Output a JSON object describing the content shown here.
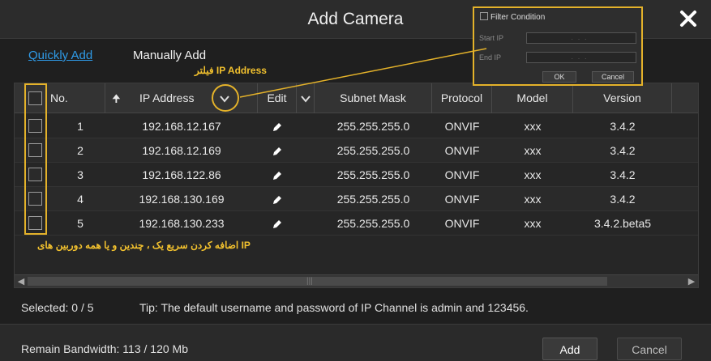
{
  "dialog": {
    "title": "Add Camera"
  },
  "tabs": [
    {
      "label": "Quickly Add",
      "active": true
    },
    {
      "label": "Manually Add",
      "active": false
    }
  ],
  "annotations": {
    "filter_label": "فیلتر IP Address",
    "quick_add_label": "اضافه کردن سریع یک ، چندین و یا همه دوربین های IP"
  },
  "table": {
    "columns": [
      {
        "key": "no",
        "label": "No."
      },
      {
        "key": "ip",
        "label": "IP Address",
        "sort_icon": "sort-up-arrow-icon",
        "filter_icon": "chevron-down-icon"
      },
      {
        "key": "edit",
        "label": "Edit",
        "filter_icon": "chevron-down-icon"
      },
      {
        "key": "subnet",
        "label": "Subnet Mask"
      },
      {
        "key": "protocol",
        "label": "Protocol"
      },
      {
        "key": "model",
        "label": "Model"
      },
      {
        "key": "version",
        "label": "Version"
      }
    ],
    "rows": [
      {
        "no": "1",
        "ip": "192.168.12.167",
        "subnet": "255.255.255.0",
        "protocol": "ONVIF",
        "model": "xxx",
        "version": "3.4.2"
      },
      {
        "no": "2",
        "ip": "192.168.12.169",
        "subnet": "255.255.255.0",
        "protocol": "ONVIF",
        "model": "xxx",
        "version": "3.4.2"
      },
      {
        "no": "3",
        "ip": "192.168.122.86",
        "subnet": "255.255.255.0",
        "protocol": "ONVIF",
        "model": "xxx",
        "version": "3.4.2"
      },
      {
        "no": "4",
        "ip": "192.168.130.169",
        "subnet": "255.255.255.0",
        "protocol": "ONVIF",
        "model": "xxx",
        "version": "3.4.2"
      },
      {
        "no": "5",
        "ip": "192.168.130.233",
        "subnet": "255.255.255.0",
        "protocol": "ONVIF",
        "model": "xxx",
        "version": "3.4.2.beta5"
      }
    ]
  },
  "status": {
    "selected": "Selected: 0 / 5",
    "tip": "Tip: The default username and password of IP Channel is admin and 123456."
  },
  "footer": {
    "bandwidth": "Remain Bandwidth: 113 / 120 Mb",
    "add_label": "Add",
    "cancel_label": "Cancel"
  },
  "filter_popup": {
    "title": "Filter Condition",
    "start_ip_label": "Start IP",
    "end_ip_label": "End IP",
    "ip_placeholder": "...",
    "ok_label": "OK",
    "cancel_label": "Cancel"
  },
  "colors": {
    "accent": "#2f9be8",
    "highlight": "#e4b22a",
    "background": "#1f1f1f"
  }
}
